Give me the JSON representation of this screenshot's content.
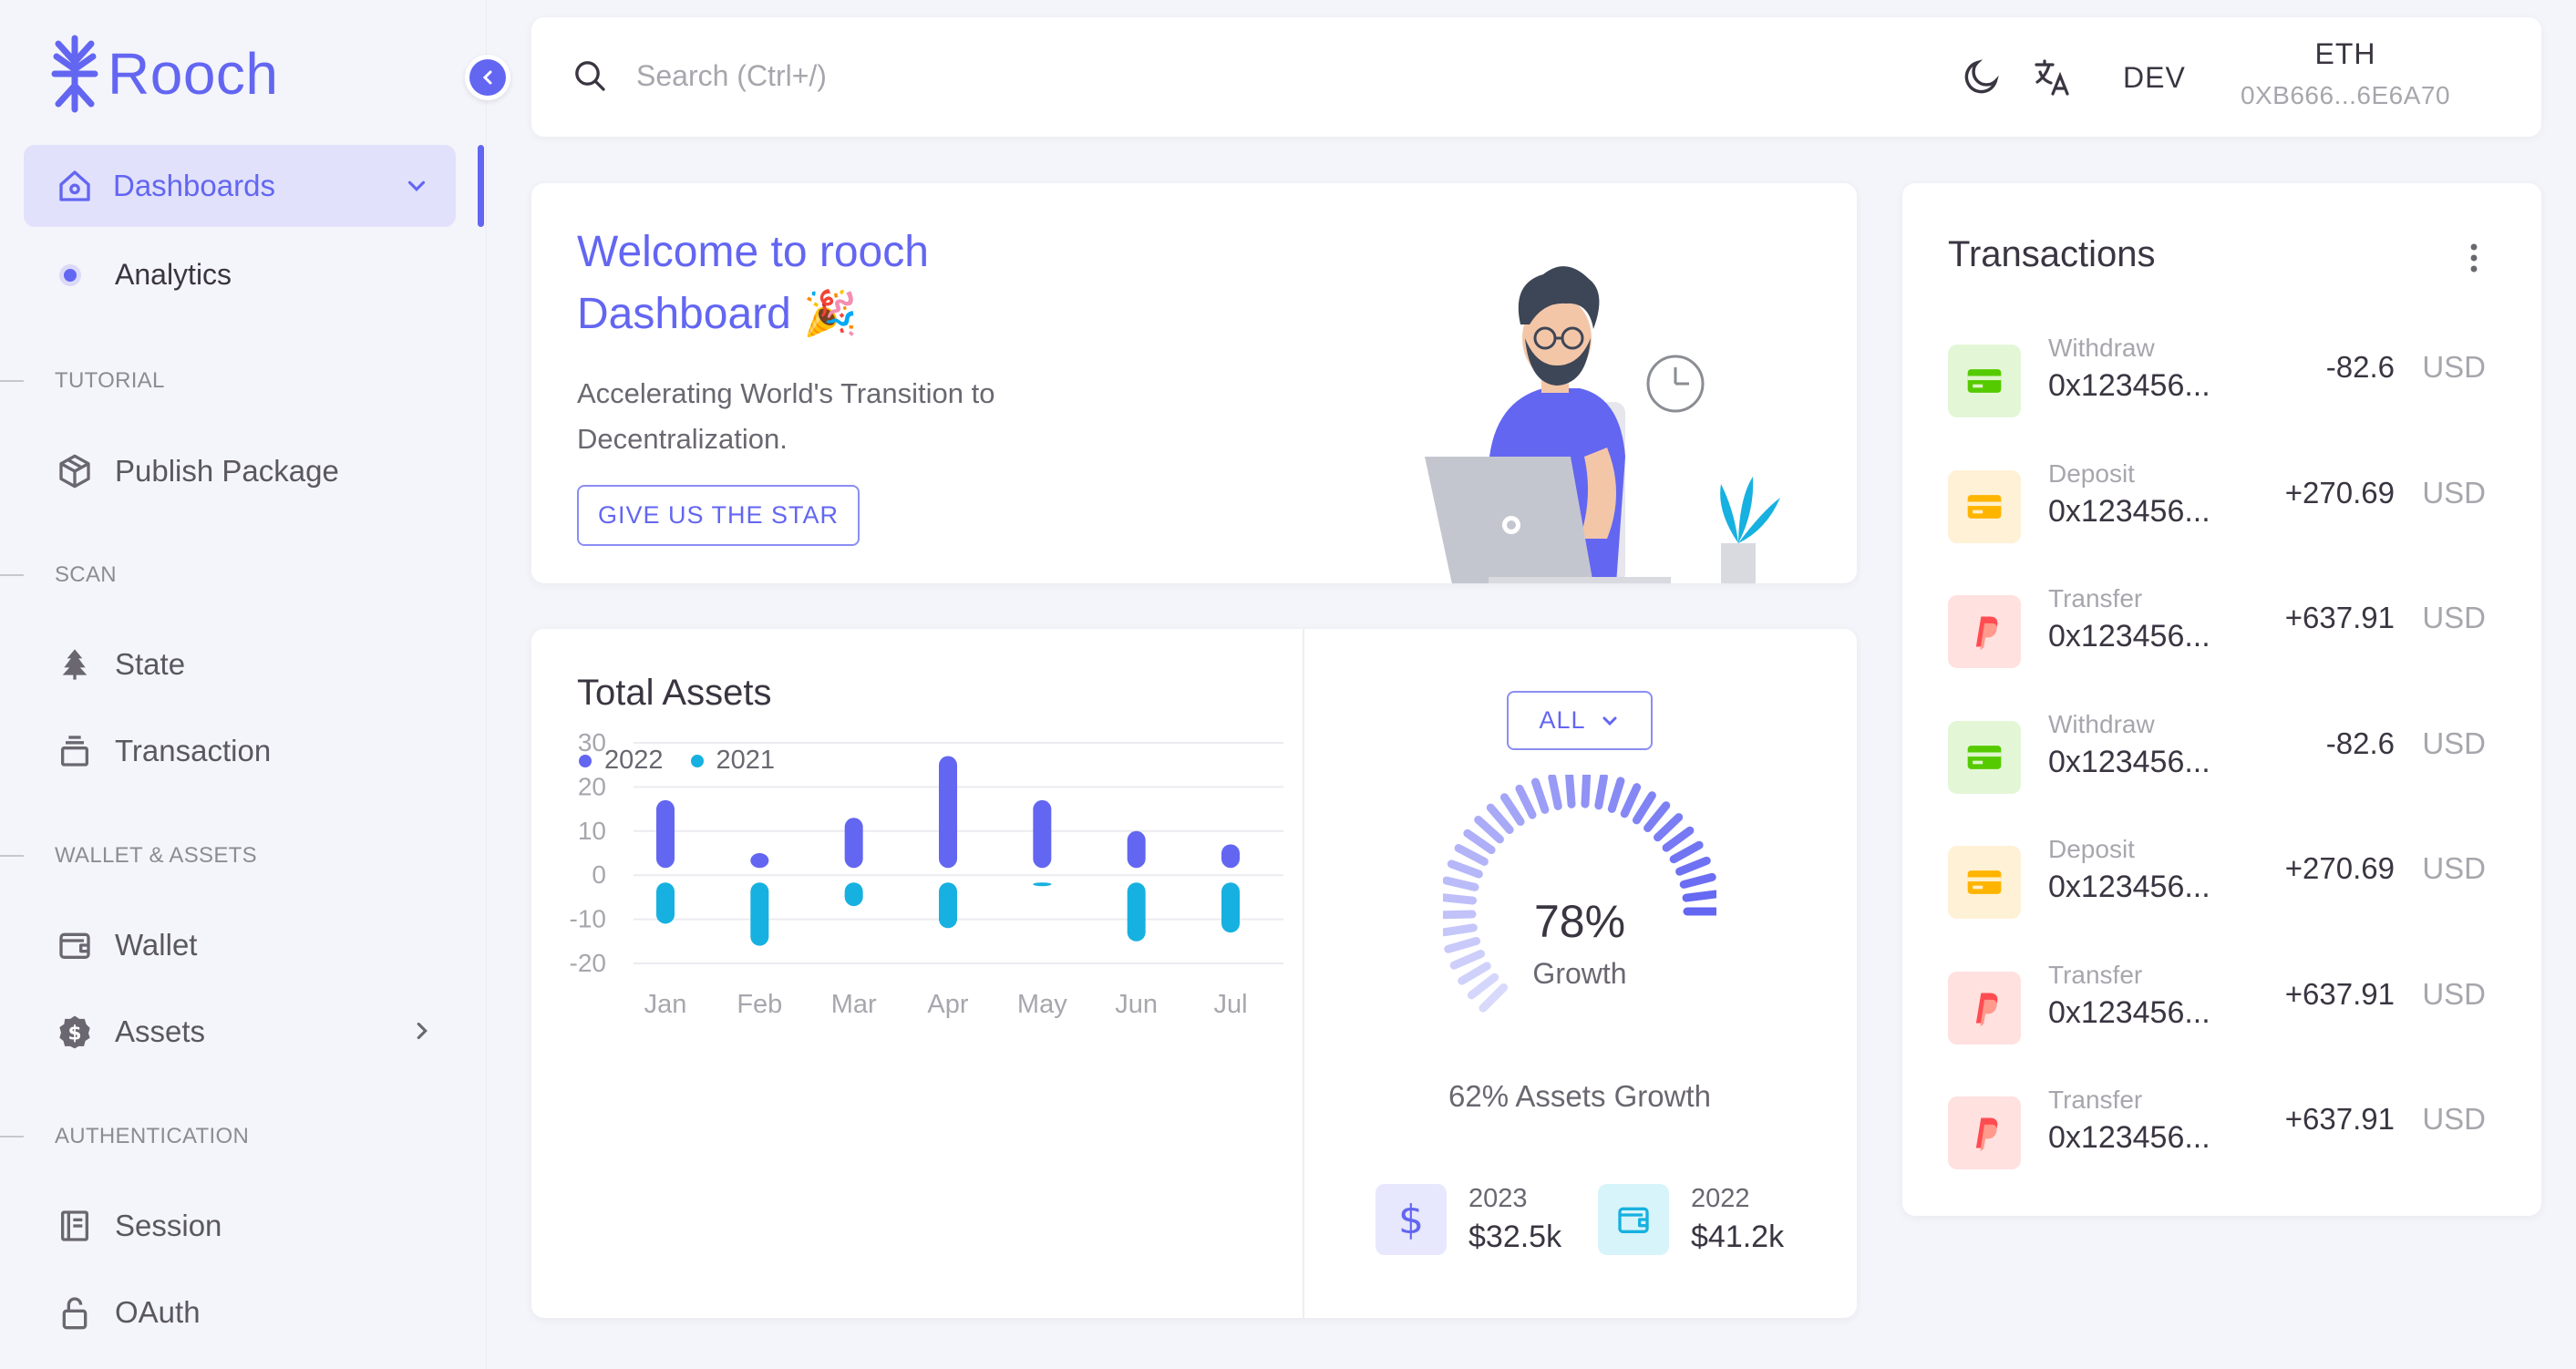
{
  "brand": {
    "name": "Rooch"
  },
  "sidebar": {
    "dashboards_label": "Dashboards",
    "analytics_label": "Analytics",
    "sections": {
      "tutorial": "TUTORIAL",
      "scan": "SCAN",
      "wallet_assets": "WALLET & ASSETS",
      "authentication": "AUTHENTICATION"
    },
    "items": {
      "publish_package": "Publish Package",
      "state": "State",
      "transaction": "Transaction",
      "wallet": "Wallet",
      "assets": "Assets",
      "session": "Session",
      "oauth": "OAuth"
    }
  },
  "topbar": {
    "search_placeholder": "Search (Ctrl+/)",
    "network": "DEV",
    "chain": "ETH",
    "address": "0XB666...6E6A70"
  },
  "welcome": {
    "title": "Welcome to rooch Dashboard 🎉",
    "subtitle": "Accelerating World's Transition to Decentralization.",
    "button": "GIVE US THE STAR"
  },
  "total_assets": {
    "title": "Total Assets",
    "filter": "ALL",
    "growth_percent": "78%",
    "growth_label": "Growth",
    "growth_value": 78,
    "summary": "62% Assets Growth",
    "stats": [
      {
        "year": "2023",
        "value": "$32.5k"
      },
      {
        "year": "2022",
        "value": "$41.2k"
      }
    ]
  },
  "chart_data": {
    "type": "bar",
    "categories": [
      "Jan",
      "Feb",
      "Mar",
      "Apr",
      "May",
      "Jun",
      "Jul"
    ],
    "series": [
      {
        "name": "2022",
        "values": [
          17,
          5,
          13,
          27,
          17,
          10,
          7
        ],
        "color": "#6366F1"
      },
      {
        "name": "2021",
        "values": [
          -11,
          -16,
          -7,
          -12,
          -2,
          -15,
          -13
        ],
        "color": "#16B1E0"
      }
    ],
    "ylim": [
      -20,
      30
    ],
    "yticks": [
      "30",
      "20",
      "10",
      "0",
      "-10",
      "-20"
    ],
    "grid": true,
    "legend": "top-left"
  },
  "transactions": {
    "title": "Transactions",
    "items": [
      {
        "type": "Withdraw",
        "address": "0x123456...",
        "amount": "-82.6",
        "currency": "USD",
        "icon": "card-icon",
        "bg": "#E3F7D7",
        "color": "#56CA00"
      },
      {
        "type": "Deposit",
        "address": "0x123456...",
        "amount": "+270.69",
        "currency": "USD",
        "icon": "card-icon",
        "bg": "#FFF1D6",
        "color": "#FFB400"
      },
      {
        "type": "Transfer",
        "address": "0x123456...",
        "amount": "+637.91",
        "currency": "USD",
        "icon": "paypal-icon",
        "bg": "#FFE1E0",
        "color": "#FF4C51"
      },
      {
        "type": "Withdraw",
        "address": "0x123456...",
        "amount": "-82.6",
        "currency": "USD",
        "icon": "card-icon",
        "bg": "#E3F7D7",
        "color": "#56CA00"
      },
      {
        "type": "Deposit",
        "address": "0x123456...",
        "amount": "+270.69",
        "currency": "USD",
        "icon": "card-icon",
        "bg": "#FFF1D6",
        "color": "#FFB400"
      },
      {
        "type": "Transfer",
        "address": "0x123456...",
        "amount": "+637.91",
        "currency": "USD",
        "icon": "paypal-icon",
        "bg": "#FFE1E0",
        "color": "#FF4C51"
      },
      {
        "type": "Transfer",
        "address": "0x123456...",
        "amount": "+637.91",
        "currency": "USD",
        "icon": "paypal-icon",
        "bg": "#FFE1E0",
        "color": "#FF4C51"
      }
    ]
  },
  "colors": {
    "primary": "#6366F1",
    "secondary": "#16B1E0"
  }
}
